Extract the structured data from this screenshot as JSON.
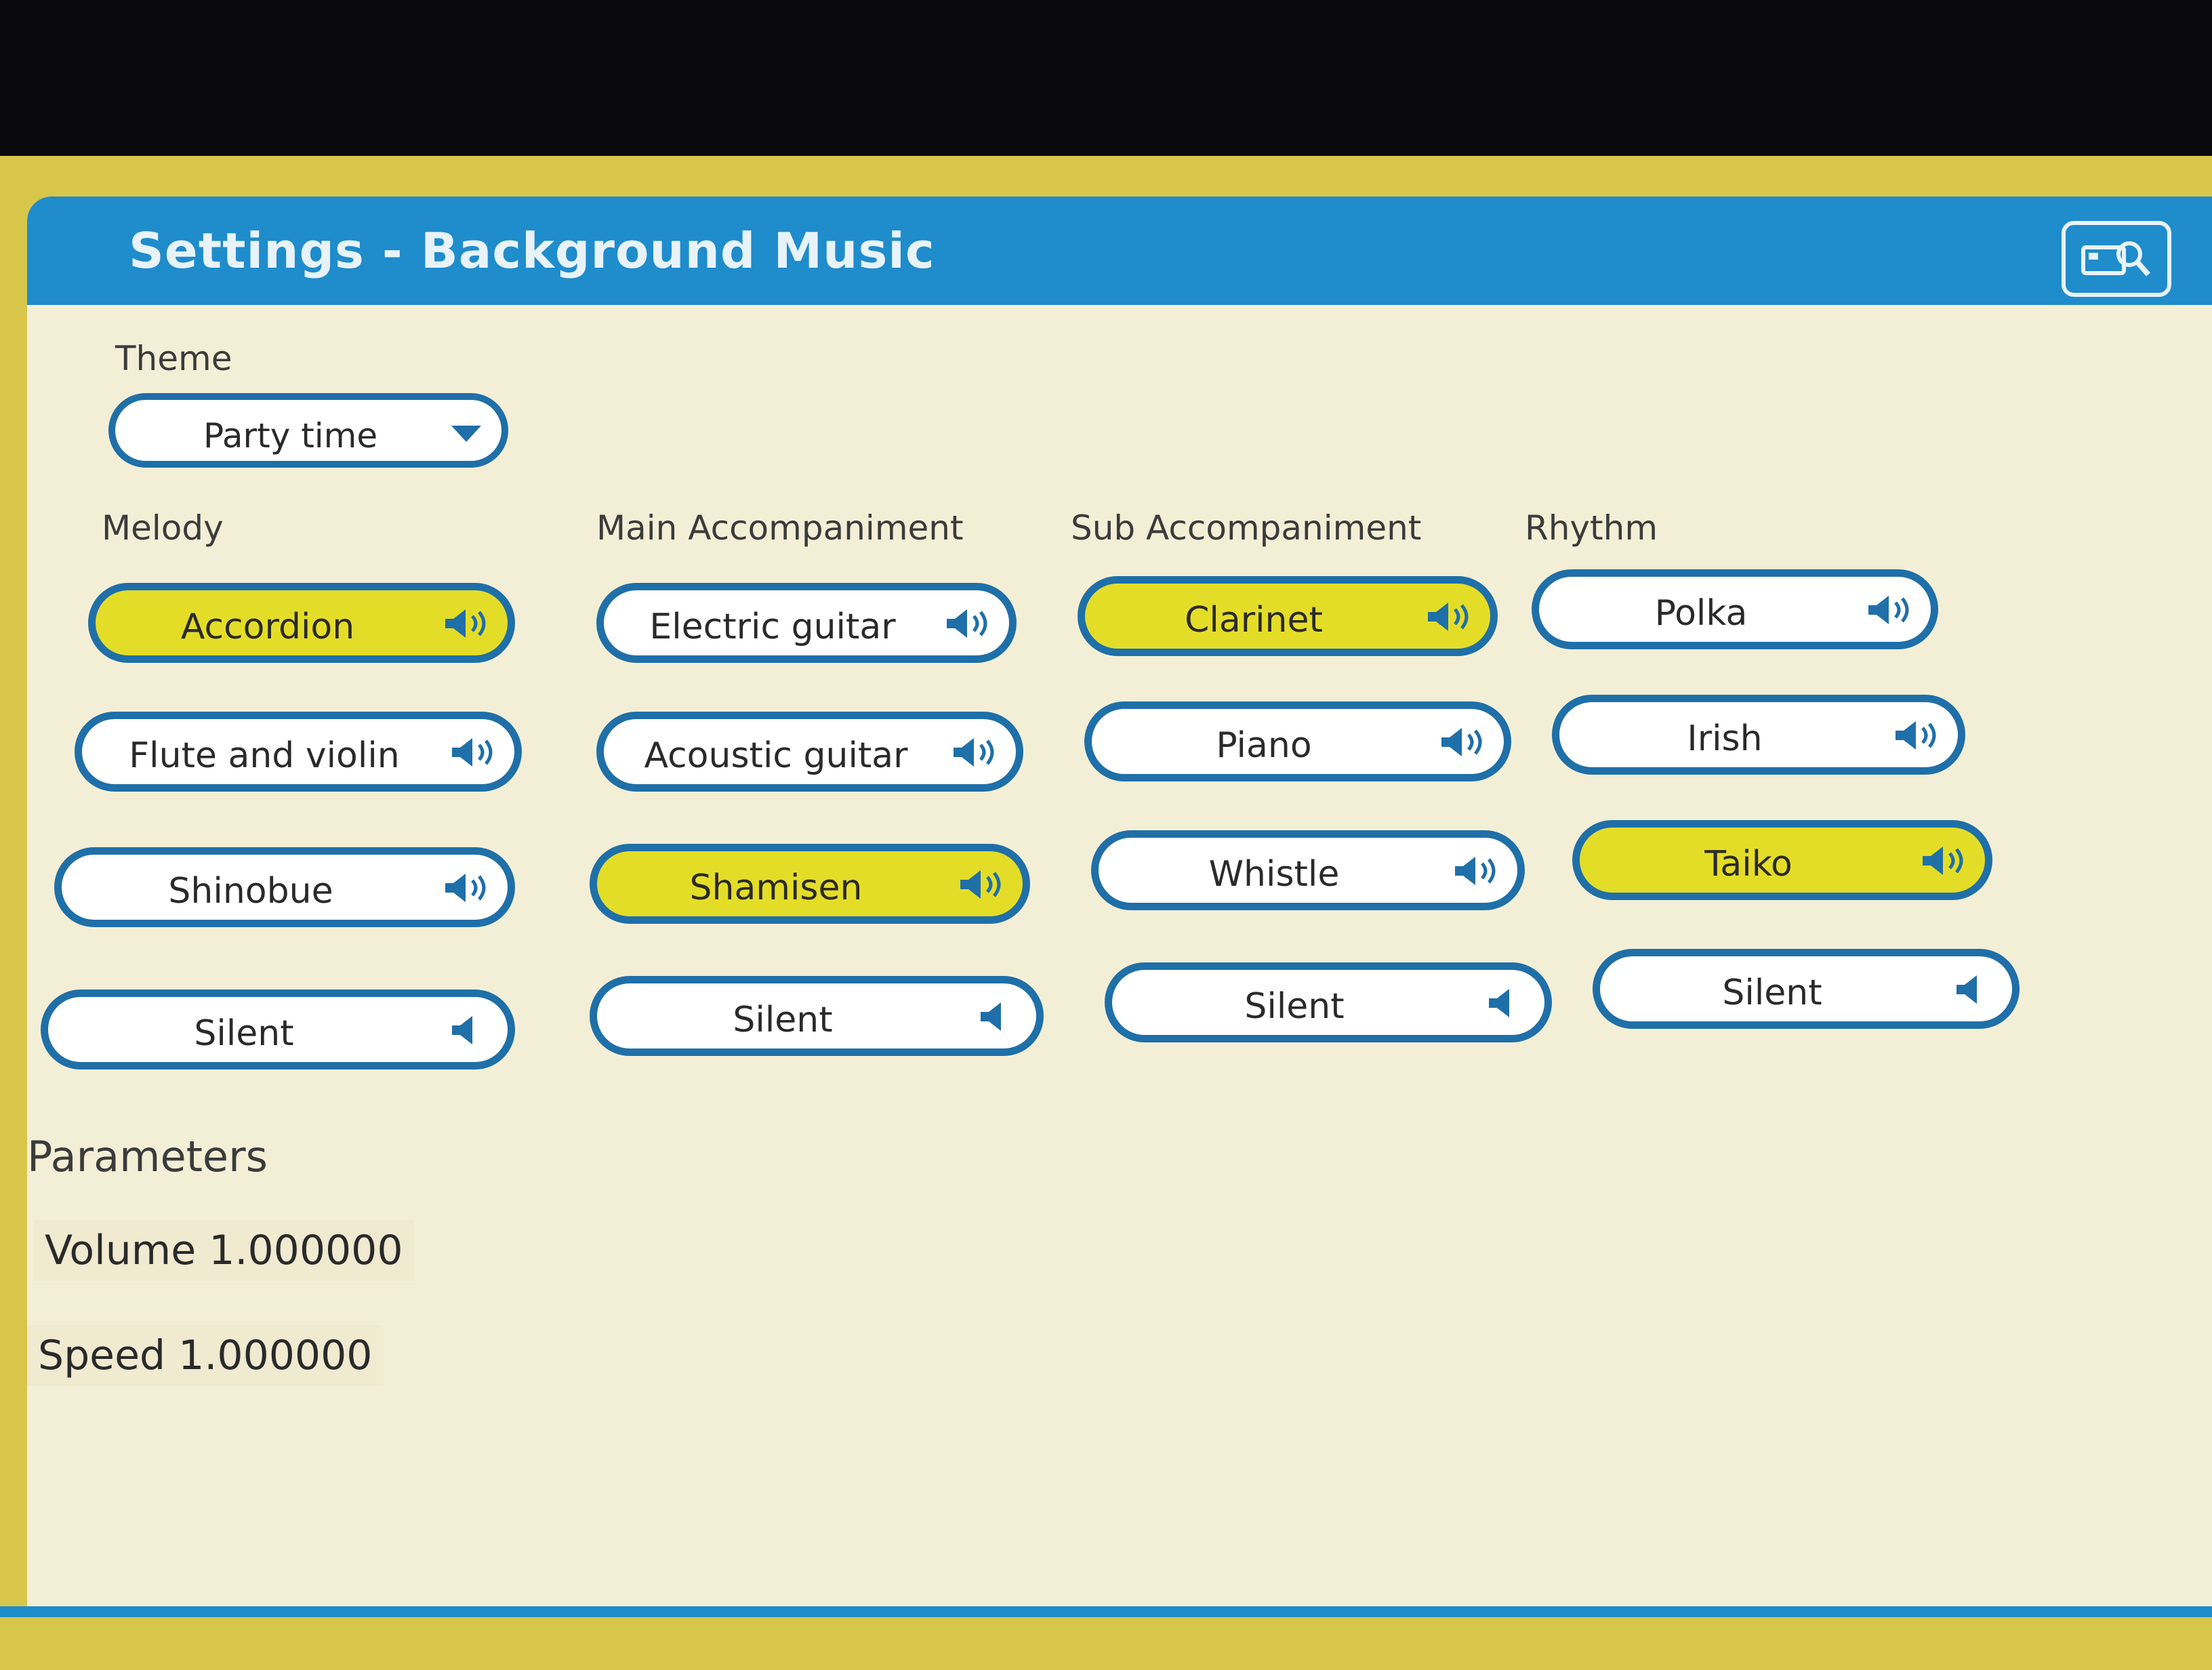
{
  "dialog": {
    "title": "Settings - Background Music"
  },
  "theme": {
    "label": "Theme",
    "value": "Party time"
  },
  "columns": [
    {
      "label": "Melody",
      "items": [
        {
          "label": "Accordion",
          "selected": true,
          "icon": "speaker-sound-icon"
        },
        {
          "label": "Flute and violin",
          "selected": false,
          "icon": "speaker-sound-icon"
        },
        {
          "label": "Shinobue",
          "selected": false,
          "icon": "speaker-sound-icon"
        },
        {
          "label": "Silent",
          "selected": false,
          "icon": "speaker-muted-icon"
        }
      ]
    },
    {
      "label": "Main Accompaniment",
      "items": [
        {
          "label": "Electric guitar",
          "selected": false,
          "icon": "speaker-sound-icon"
        },
        {
          "label": "Acoustic guitar",
          "selected": false,
          "icon": "speaker-sound-icon"
        },
        {
          "label": "Shamisen",
          "selected": true,
          "icon": "speaker-sound-icon"
        },
        {
          "label": "Silent",
          "selected": false,
          "icon": "speaker-muted-icon"
        }
      ]
    },
    {
      "label": "Sub Accompaniment",
      "items": [
        {
          "label": "Clarinet",
          "selected": true,
          "icon": "speaker-sound-icon"
        },
        {
          "label": "Piano",
          "selected": false,
          "icon": "speaker-sound-icon"
        },
        {
          "label": "Whistle",
          "selected": false,
          "icon": "speaker-sound-icon"
        },
        {
          "label": "Silent",
          "selected": false,
          "icon": "speaker-muted-icon"
        }
      ]
    },
    {
      "label": "Rhythm",
      "items": [
        {
          "label": "Polka",
          "selected": false,
          "icon": "speaker-sound-icon"
        },
        {
          "label": "Irish",
          "selected": false,
          "icon": "speaker-sound-icon"
        },
        {
          "label": "Taiko",
          "selected": true,
          "icon": "speaker-sound-icon"
        },
        {
          "label": "Silent",
          "selected": false,
          "icon": "speaker-muted-icon"
        }
      ]
    }
  ],
  "parameters": {
    "label": "Parameters",
    "volume": "Volume 1.000000",
    "speed": "Speed 1.000000"
  },
  "colors": {
    "titlebar": "#1f8ccc",
    "selected": "#e4dd28",
    "border": "#1f6fa8",
    "background": "#f3efd6"
  }
}
